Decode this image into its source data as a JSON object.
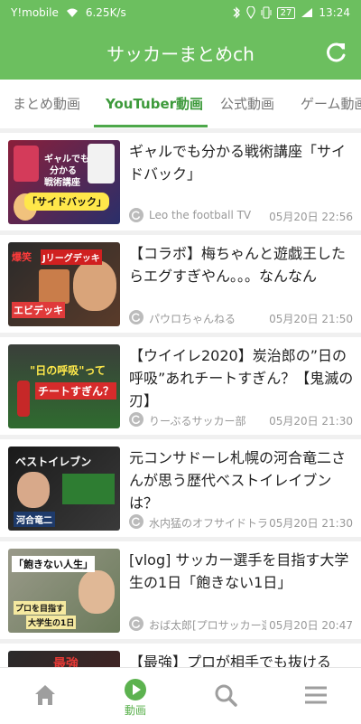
{
  "status": {
    "carrier": "Y!mobile",
    "speed": "6.25K/s",
    "battery": "27",
    "time": "13:24"
  },
  "app": {
    "title": "サッカーまとめch",
    "primary_color": "#6cbf5f"
  },
  "tabs": [
    {
      "label": "まとめ動画"
    },
    {
      "label": "YouTuber動画",
      "active": true
    },
    {
      "label": "公式動画"
    },
    {
      "label": "ゲーム動画"
    }
  ],
  "videos": [
    {
      "title": "ギャルでも分かる戦術講座「サイドバック」",
      "channel": "Leo the football TV",
      "date": "05月20日 22:56",
      "thumb_text": [
        "ギャルでも",
        "分かる",
        "戦術講座",
        "「サイドバック」"
      ]
    },
    {
      "title": "【コラボ】梅ちゃんと遊戯王したらエグすぎやん。。。なんなん",
      "channel": "パウロちゃんねる",
      "date": "05月20日 21:50",
      "thumb_text": [
        "爆笑",
        "Jリーグデッキ",
        "エビデッキ"
      ]
    },
    {
      "title": "【ウイイレ2020】炭治郎の”日の呼吸”あれチートすぎん？【鬼滅の刃】",
      "channel": "りーぶるサッカー部",
      "date": "05月20日 21:30",
      "thumb_text": [
        "\"日の呼吸\"って",
        "チートすぎん？"
      ]
    },
    {
      "title": "元コンサドーレ札幌の河合竜二さんが思う歴代ベストイレイブンは？",
      "channel": "水内猛のオフサイドトラップ",
      "date": "05月20日 21:30",
      "thumb_text": [
        "ベストイレブン",
        "河合竜二"
      ]
    },
    {
      "title": "[vlog] サッカー選手を目指す大学生の1日「飽きない1日」",
      "channel": "おば太郎[プロサッカー選手を目指す]",
      "date": "05月20日 20:47",
      "thumb_text": [
        "「飽きない人生」",
        "プロを目指す",
        "大学生の1日"
      ]
    },
    {
      "title": "【最強】プロが相手でも抜ける",
      "channel": "",
      "date": "",
      "thumb_text": [
        "最強"
      ]
    }
  ],
  "bottom_nav": [
    {
      "icon": "home-icon",
      "label": ""
    },
    {
      "icon": "play-circle-icon",
      "label": "動画",
      "active": true
    },
    {
      "icon": "search-icon",
      "label": ""
    },
    {
      "icon": "menu-icon",
      "label": ""
    }
  ]
}
